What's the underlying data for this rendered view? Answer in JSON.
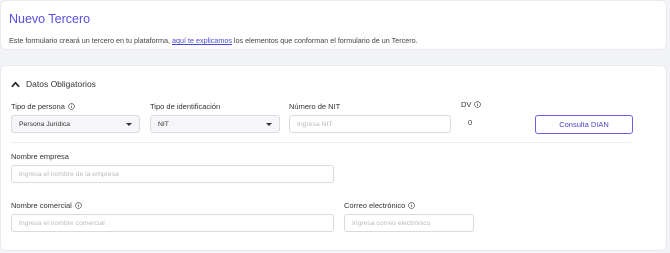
{
  "header": {
    "title": "Nuevo Tercero",
    "description_before": "Este formulario creará un tercero en tu plataforma, ",
    "description_link": "aquí te explicamos",
    "description_after": " los elementos que conforman el formulario de un Tercero."
  },
  "section": {
    "title": "Datos Obligatorios",
    "expanded": true
  },
  "fields": {
    "tipo_persona": {
      "label": "Tipo de persona",
      "value": "Persona Jurídica",
      "icon": "info-icon"
    },
    "tipo_identificacion": {
      "label": "Tipo de identificación",
      "value": "NIT"
    },
    "numero_nit": {
      "label": "Número de NIT",
      "placeholder": "Ingresa NIT"
    },
    "dv": {
      "label": "DV",
      "value": "0",
      "icon": "info-icon"
    },
    "nombre_empresa": {
      "label": "Nombre empresa",
      "placeholder": "Ingresa el nombre de la empresa"
    },
    "nombre_comercial": {
      "label": "Nombre comercial",
      "placeholder": "Ingresa el nombre comercial",
      "icon": "info-icon"
    },
    "correo": {
      "label": "Correo electrónico",
      "placeholder": "Ingresa correo electrónico",
      "icon": "info-icon"
    }
  },
  "buttons": {
    "consulta_dian": "Consulta DIAN"
  },
  "colors": {
    "accent": "#5b4ee0",
    "link": "#4a4ad8",
    "border": "#d9dbe3",
    "background": "#f3f4f7"
  }
}
